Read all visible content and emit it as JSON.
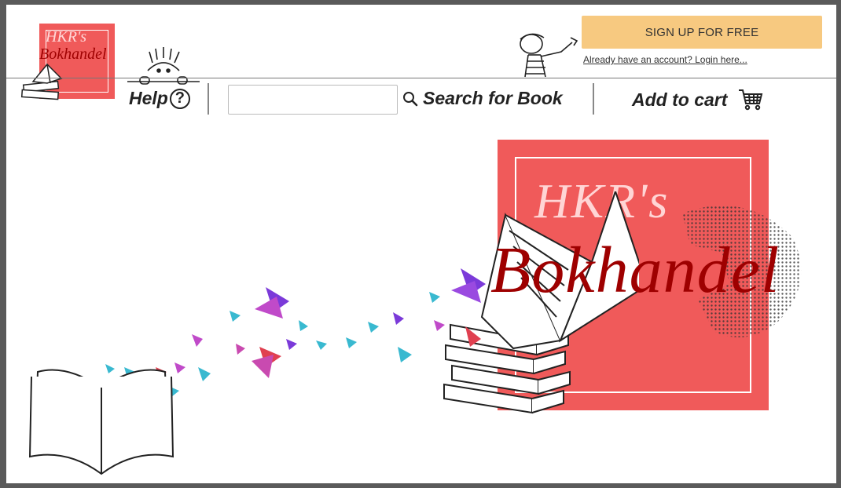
{
  "brand": {
    "logo_line1": "HKR's",
    "logo_line2": "Bokhandel"
  },
  "header": {
    "signup_label": "SIGN UP FOR FREE",
    "login_link": "Already have an account? Login here..."
  },
  "nav": {
    "help_label": "Help",
    "help_icon_glyph": "?",
    "search_placeholder": "",
    "search_label": "Search for Book",
    "cart_label": "Add to cart"
  },
  "colors": {
    "brand_red": "#f05a5a",
    "brand_dark_red": "#9e0000",
    "signup_button": "#f7c980"
  },
  "icons": {
    "help": "question-circle-icon",
    "search": "magnifier-icon",
    "cart": "shopping-cart-icon"
  }
}
